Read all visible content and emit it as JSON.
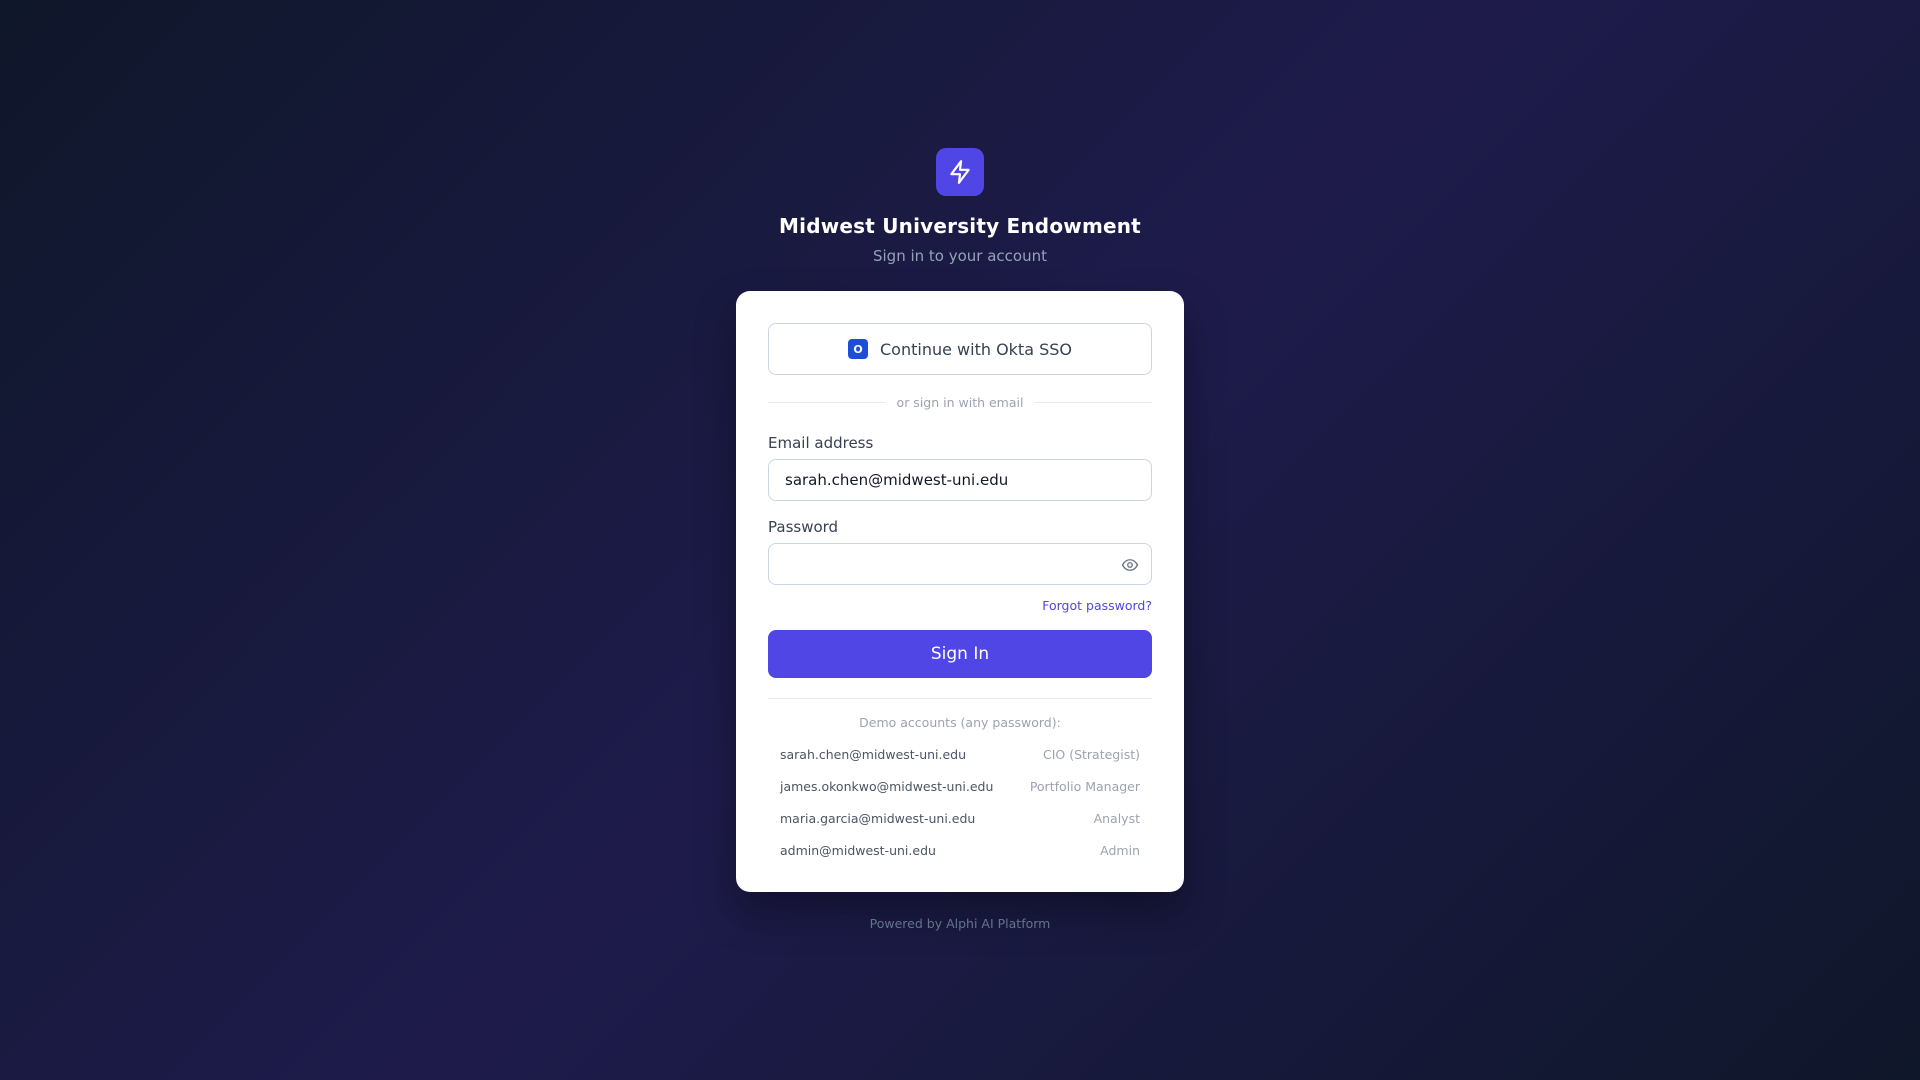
{
  "brand": {
    "logo_icon": "lightning-bolt-icon",
    "title": "Midwest University Endowment",
    "subtitle": "Sign in to your account",
    "accent_color": "#4f46e5"
  },
  "sso": {
    "badge": "O",
    "label": "Continue with Okta SSO"
  },
  "divider_text": "or sign in with email",
  "email": {
    "label": "Email address",
    "value": "sarah.chen@midwest-uni.edu"
  },
  "password": {
    "label": "Password",
    "value": "",
    "toggle_icon": "eye-icon"
  },
  "forgot_label": "Forgot password?",
  "signin_label": "Sign In",
  "demo": {
    "title": "Demo accounts (any password):",
    "accounts": [
      {
        "email": "sarah.chen@midwest-uni.edu",
        "role": "CIO (Strategist)"
      },
      {
        "email": "james.okonkwo@midwest-uni.edu",
        "role": "Portfolio Manager"
      },
      {
        "email": "maria.garcia@midwest-uni.edu",
        "role": "Analyst"
      },
      {
        "email": "admin@midwest-uni.edu",
        "role": "Admin"
      }
    ]
  },
  "footer": "Powered by Alphi AI Platform"
}
